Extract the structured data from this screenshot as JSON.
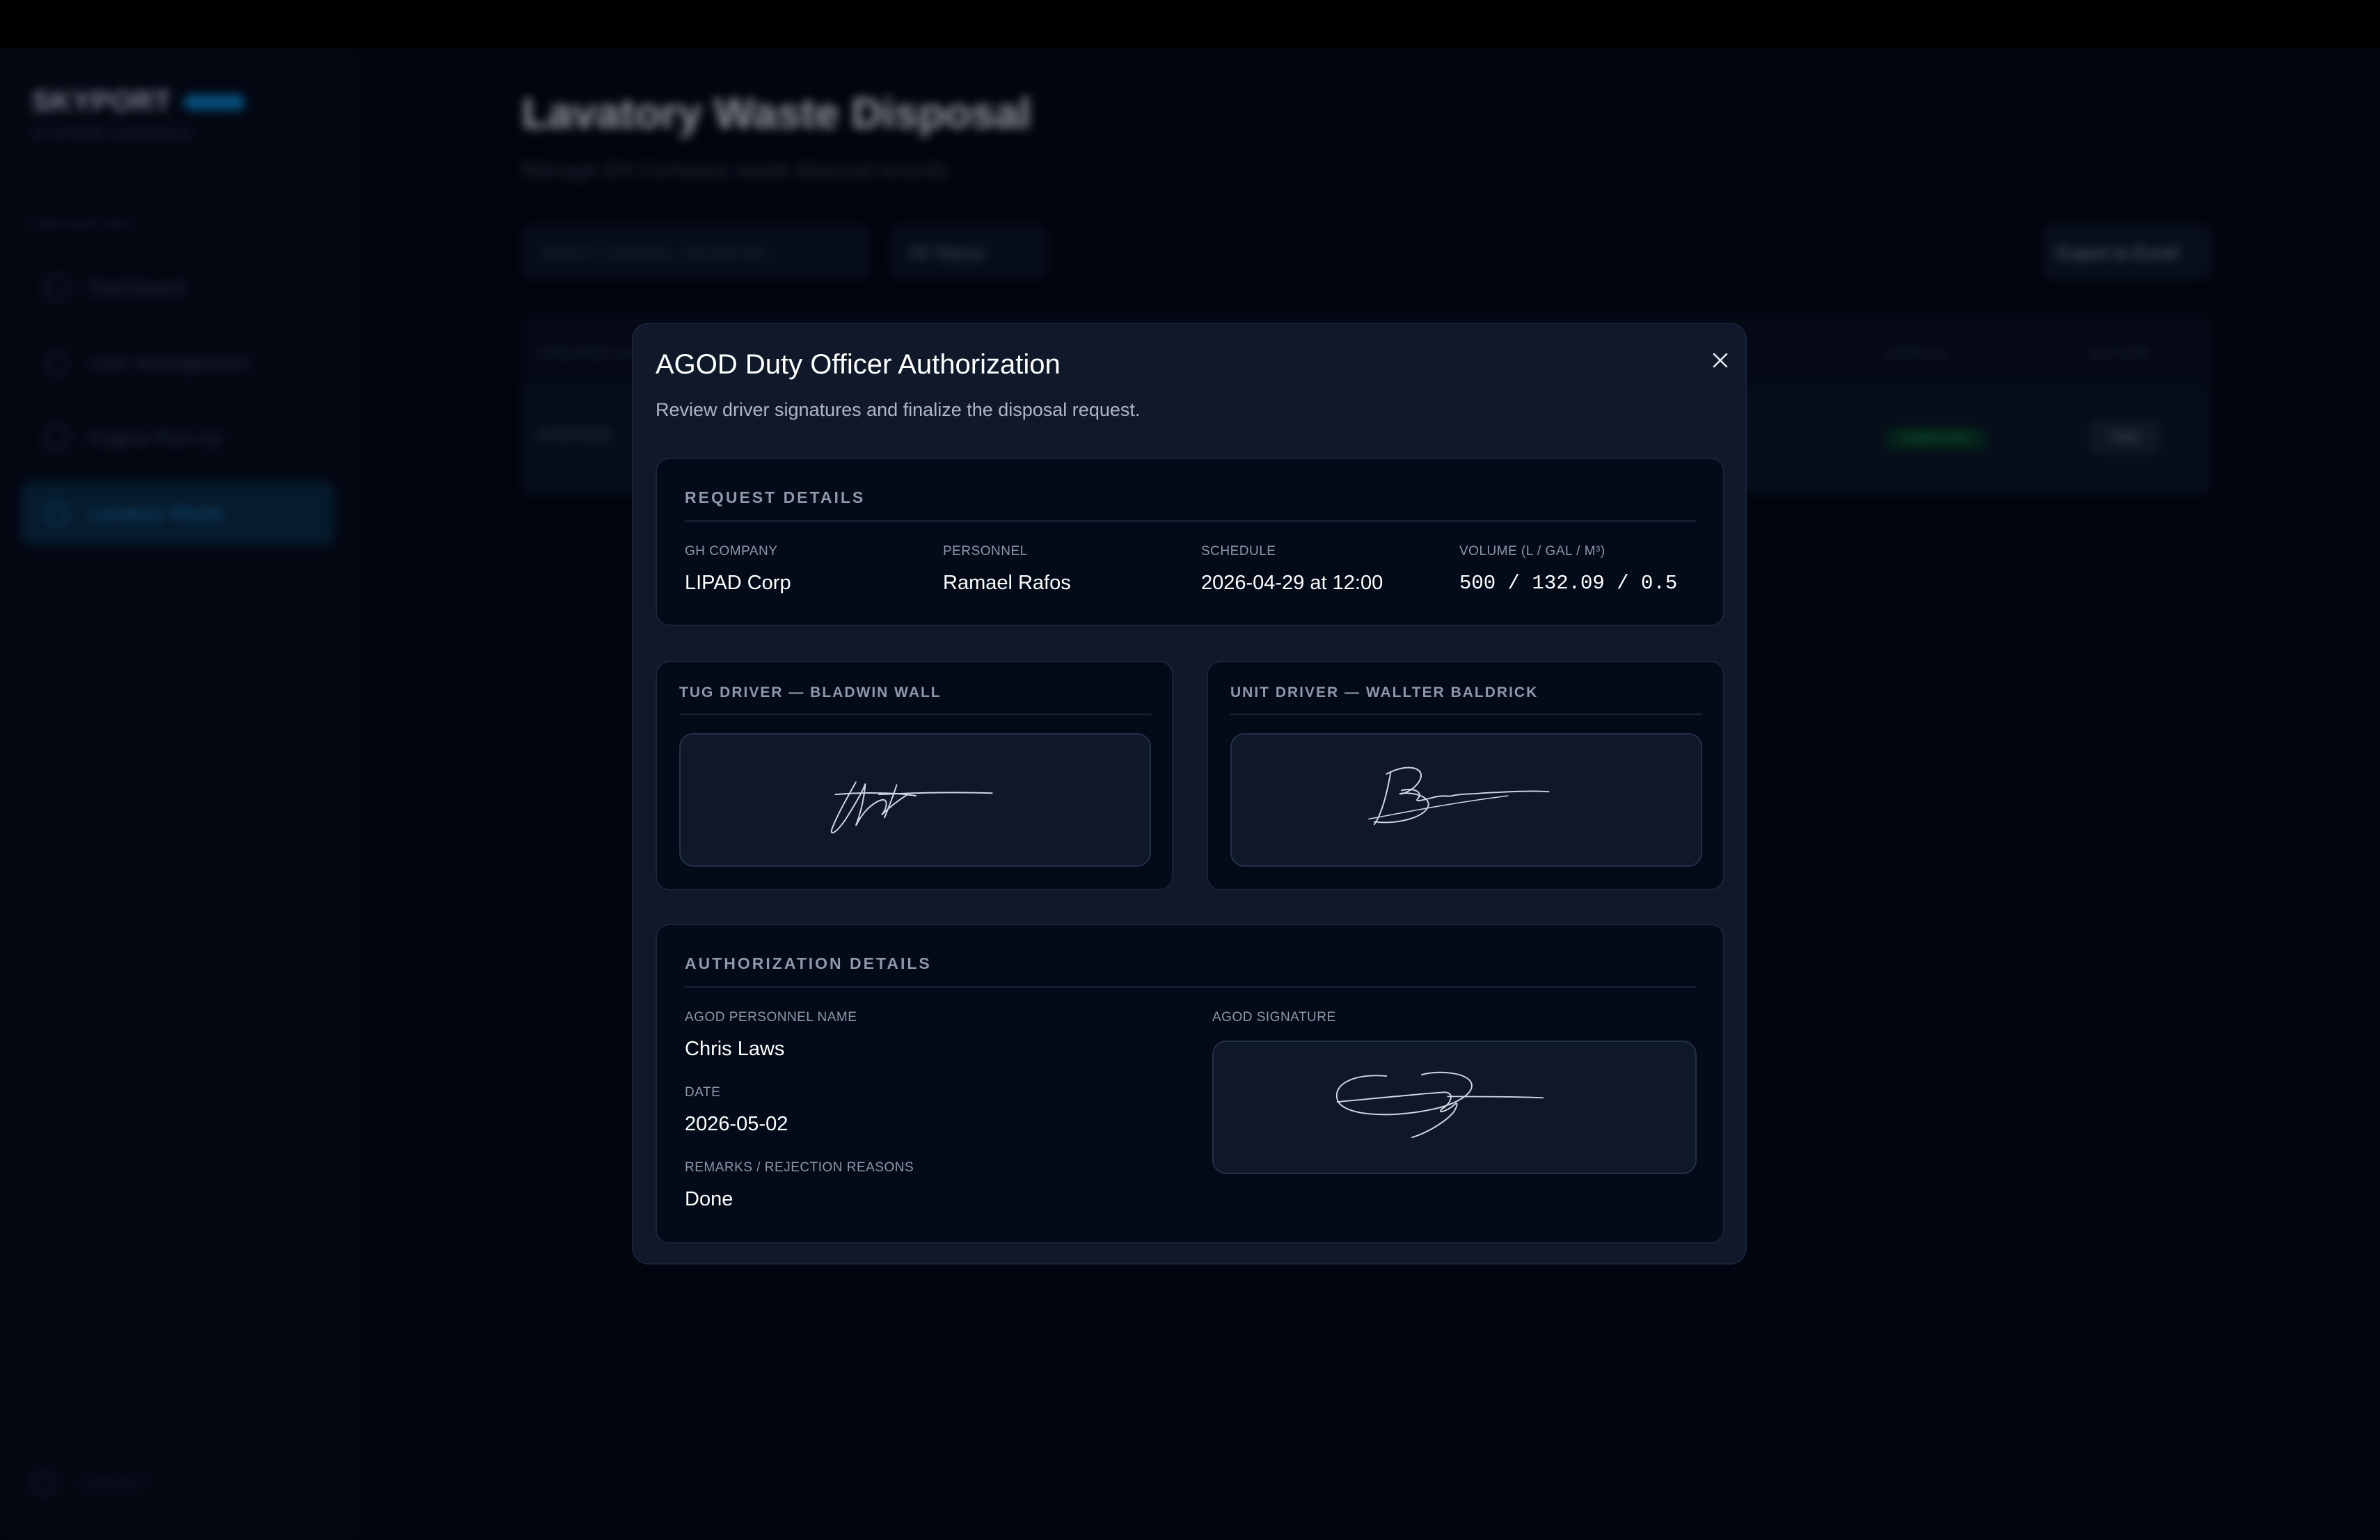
{
  "app": {
    "brand": "SKYPORT",
    "brand_badge": "ADMIN",
    "brand_sub": "SYSTEM CONSOLE",
    "nav_header": "NAVIGATION",
    "nav_items": [
      {
        "label": "Dashboard",
        "icon": "grid-icon",
        "active": false
      },
      {
        "label": "User Management",
        "icon": "user-icon",
        "active": false
      },
      {
        "label": "Engine Run-Up",
        "icon": "plane-icon",
        "active": false
      },
      {
        "label": "Lavatory Waste",
        "icon": "waste-icon",
        "active": true
      }
    ],
    "logout": "LOGOUT"
  },
  "page": {
    "title": "Lavatory Waste Disposal",
    "subtitle": "Manage GH Company waste disposal records",
    "search_placeholder": "Search company, personnel...",
    "status_filter": "All Status",
    "export_label": "Export to Excel",
    "table": {
      "headers": [
        "CREATED AT",
        "STATUS",
        "ACTION"
      ],
      "rows": [
        {
          "created": "4/29/2026",
          "status": "COMPLETED",
          "action": "View"
        }
      ]
    }
  },
  "modal": {
    "title": "AGOD Duty Officer Authorization",
    "subtitle": "Review driver signatures and finalize the disposal request.",
    "request_details": {
      "title": "REQUEST DETAILS",
      "fields": [
        {
          "label": "GH COMPANY",
          "value": "LIPAD Corp"
        },
        {
          "label": "PERSONNEL",
          "value": "Ramael Rafos"
        },
        {
          "label": "SCHEDULE",
          "value": "2026-04-29 at 12:00"
        },
        {
          "label": "VOLUME (L / GAL / M³)",
          "value": "500 / 132.09 / 0.5"
        }
      ]
    },
    "tug_driver": {
      "title": "TUG DRIVER — BLADWIN WALL"
    },
    "unit_driver": {
      "title": "UNIT DRIVER — WALLTER BALDRICK"
    },
    "authorization": {
      "title": "AUTHORIZATION DETAILS",
      "personnel_label": "AGOD PERSONNEL NAME",
      "personnel_value": "Chris Laws",
      "date_label": "DATE",
      "date_value": "2026-05-02",
      "remarks_label": "REMARKS / REJECTION REASONS",
      "remarks_value": "Done",
      "signature_label": "AGOD SIGNATURE"
    }
  },
  "colors": {
    "accent": "#0b7fc4",
    "status_completed": "#1fb873",
    "modal_bg": "#0f192a",
    "card_bg": "#030a18"
  }
}
